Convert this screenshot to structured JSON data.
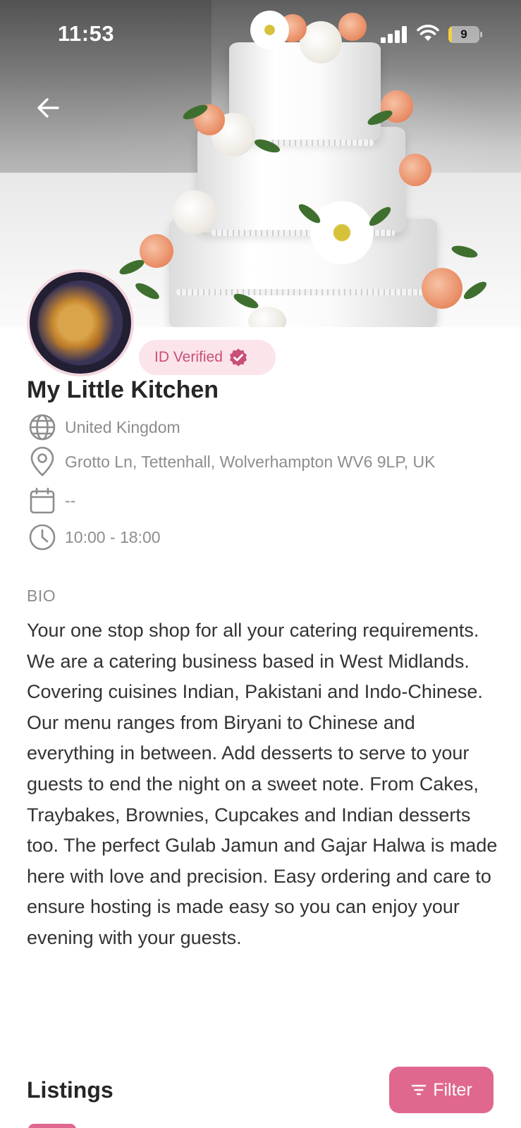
{
  "status_bar": {
    "time": "11:53",
    "battery_level": "9",
    "battery_fraction": 0.09,
    "icons": [
      "cellular-signal-icon",
      "wifi-icon",
      "battery-icon"
    ]
  },
  "hero": {
    "back_icon": "arrow-left-icon"
  },
  "profile": {
    "badge_label": "ID Verified",
    "name": "My Little Kitchen",
    "country": "United Kingdom",
    "address": "Grotto Ln, Tettenhall, Wolverhampton WV6 9LP, UK",
    "date": "--",
    "hours": "10:00 - 18:00"
  },
  "bio": {
    "heading": "BIO",
    "text": "Your one stop shop for all your catering requirements. We are a catering business based in West Midlands. Covering cuisines Indian, Pakistani and Indo-Chinese. Our menu ranges from Biryani to Chinese and everything in between. Add desserts to serve to your guests to end the night on a sweet note. From Cakes, Traybakes, Brownies, Cupcakes and Indian desserts too. The perfect Gulab Jamun and Gajar Halwa is made here with love and precision. Easy ordering and care to ensure hosting is made easy so you can enjoy your evening with your guests."
  },
  "listings": {
    "heading": "Listings",
    "filter_label": "Filter"
  },
  "colors": {
    "accent": "#e0688e",
    "badge_bg": "#fbe4ea",
    "badge_text": "#c94f78",
    "muted_text": "#8d8d8d"
  }
}
